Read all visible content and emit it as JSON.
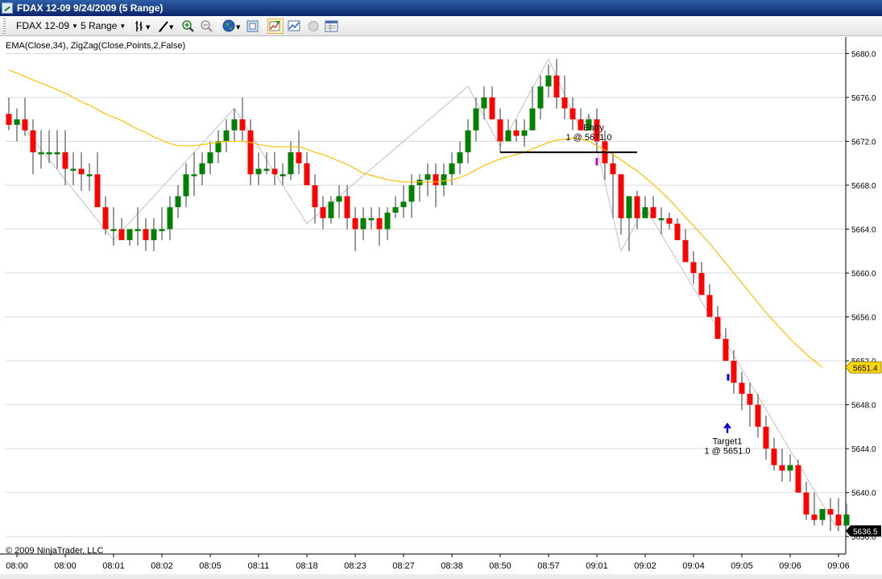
{
  "window": {
    "title": "FDAX 12-09  9/24/2009 (5 Range)"
  },
  "toolbar": {
    "instrument": "FDAX 12-09",
    "period": "5 Range",
    "icons": [
      "bar-style-icon",
      "drawing-pen-icon",
      "zoom-in-icon",
      "zoom-out-icon",
      "globe-icon",
      "properties-icon",
      "strategy-icon",
      "chart-trader-icon",
      "record-icon",
      "data-box-icon"
    ]
  },
  "chart": {
    "indicator_label": "EMA(Close,34), ZigZag(Close,Points,2,False)",
    "copyright": "© 2009 NinjaTrader, LLC",
    "colors": {
      "up": "#008000",
      "down": "#ff0000",
      "wick": "#808080",
      "ema": "#ffc000",
      "zigzag": "#c0c0c0",
      "grid": "#d9d9d9",
      "entry_line": "#000000",
      "target_arrow": "#0000cc",
      "last_price_marker": "#000000",
      "ema_marker": "#ffd700"
    }
  },
  "chart_data": {
    "type": "candlestick",
    "title": "",
    "ylim": [
      5634.4,
      5681.5
    ],
    "y_ticks": [
      5680.0,
      5676.0,
      5672.0,
      5668.0,
      5664.0,
      5660.0,
      5656.0,
      5652.0,
      5648.0,
      5644.0,
      5640.0,
      5636.0
    ],
    "y_tick_labels": [
      "5680.0",
      "5676.0",
      "5672.0",
      "5668.0",
      "5664.0",
      "5660.0",
      "5656.0",
      "5652.0",
      "5648.0",
      "5644.0",
      "5640.0",
      "5636.0"
    ],
    "x_tick_labels": [
      "08:00",
      "08:00",
      "08:01",
      "08:02",
      "08:05",
      "08:11",
      "08:18",
      "08:23",
      "08:27",
      "08:38",
      "08:50",
      "08:57",
      "09:01",
      "09:02",
      "09:04",
      "09:05",
      "09:06",
      "09:06"
    ],
    "x_tick_bars": [
      1,
      7,
      13,
      19,
      25,
      31,
      37,
      43,
      49,
      55,
      61,
      67,
      73,
      79,
      85,
      91,
      97,
      103
    ],
    "bars": [
      {
        "o": 5674.5,
        "h": 5676,
        "l": 5673,
        "c": 5673.5
      },
      {
        "o": 5673.5,
        "h": 5675,
        "l": 5672,
        "c": 5674
      },
      {
        "o": 5674,
        "h": 5676,
        "l": 5672.5,
        "c": 5673
      },
      {
        "o": 5673,
        "h": 5674,
        "l": 5669,
        "c": 5671
      },
      {
        "o": 5671,
        "h": 5673,
        "l": 5669.5,
        "c": 5671
      },
      {
        "o": 5671,
        "h": 5673,
        "l": 5670,
        "c": 5671
      },
      {
        "o": 5671,
        "h": 5673,
        "l": 5669.5,
        "c": 5671
      },
      {
        "o": 5671,
        "h": 5673,
        "l": 5668,
        "c": 5669.5
      },
      {
        "o": 5669.5,
        "h": 5671,
        "l": 5668,
        "c": 5669.5
      },
      {
        "o": 5669.5,
        "h": 5671,
        "l": 5667.5,
        "c": 5669
      },
      {
        "o": 5669,
        "h": 5670,
        "l": 5667.5,
        "c": 5669
      },
      {
        "o": 5669,
        "h": 5671,
        "l": 5666,
        "c": 5666
      },
      {
        "o": 5666,
        "h": 5667,
        "l": 5663.5,
        "c": 5664
      },
      {
        "o": 5664,
        "h": 5666,
        "l": 5662.5,
        "c": 5664
      },
      {
        "o": 5664,
        "h": 5665,
        "l": 5663,
        "c": 5663
      },
      {
        "o": 5663,
        "h": 5664,
        "l": 5662.5,
        "c": 5664
      },
      {
        "o": 5664,
        "h": 5666,
        "l": 5662.5,
        "c": 5664
      },
      {
        "o": 5664,
        "h": 5665,
        "l": 5662,
        "c": 5663
      },
      {
        "o": 5663,
        "h": 5665,
        "l": 5662,
        "c": 5664
      },
      {
        "o": 5664,
        "h": 5666,
        "l": 5663,
        "c": 5664
      },
      {
        "o": 5664,
        "h": 5667,
        "l": 5663,
        "c": 5666
      },
      {
        "o": 5666,
        "h": 5668,
        "l": 5665,
        "c": 5667
      },
      {
        "o": 5667,
        "h": 5670,
        "l": 5666,
        "c": 5669
      },
      {
        "o": 5669,
        "h": 5671,
        "l": 5667,
        "c": 5669
      },
      {
        "o": 5669,
        "h": 5671,
        "l": 5668,
        "c": 5670
      },
      {
        "o": 5670,
        "h": 5672,
        "l": 5669,
        "c": 5671
      },
      {
        "o": 5671,
        "h": 5673,
        "l": 5670,
        "c": 5672
      },
      {
        "o": 5672,
        "h": 5674,
        "l": 5671,
        "c": 5673
      },
      {
        "o": 5673,
        "h": 5675,
        "l": 5672,
        "c": 5674
      },
      {
        "o": 5674,
        "h": 5676,
        "l": 5672,
        "c": 5673
      },
      {
        "o": 5673,
        "h": 5674,
        "l": 5668,
        "c": 5669
      },
      {
        "o": 5669,
        "h": 5671,
        "l": 5668,
        "c": 5669.5
      },
      {
        "o": 5669.5,
        "h": 5671,
        "l": 5669,
        "c": 5669.5
      },
      {
        "o": 5669.5,
        "h": 5671,
        "l": 5668,
        "c": 5669
      },
      {
        "o": 5669,
        "h": 5670,
        "l": 5668,
        "c": 5669
      },
      {
        "o": 5669,
        "h": 5672,
        "l": 5668.5,
        "c": 5671
      },
      {
        "o": 5671,
        "h": 5673,
        "l": 5669,
        "c": 5670
      },
      {
        "o": 5670,
        "h": 5671,
        "l": 5668,
        "c": 5668
      },
      {
        "o": 5668,
        "h": 5669,
        "l": 5664.5,
        "c": 5666
      },
      {
        "o": 5666,
        "h": 5667,
        "l": 5664,
        "c": 5665
      },
      {
        "o": 5665,
        "h": 5667,
        "l": 5664.5,
        "c": 5666.5
      },
      {
        "o": 5666.5,
        "h": 5668,
        "l": 5665,
        "c": 5667
      },
      {
        "o": 5667,
        "h": 5668,
        "l": 5664,
        "c": 5665
      },
      {
        "o": 5665,
        "h": 5666,
        "l": 5662,
        "c": 5664
      },
      {
        "o": 5664,
        "h": 5666,
        "l": 5663,
        "c": 5665
      },
      {
        "o": 5665,
        "h": 5666,
        "l": 5664,
        "c": 5665
      },
      {
        "o": 5665,
        "h": 5666,
        "l": 5662.5,
        "c": 5664
      },
      {
        "o": 5664,
        "h": 5666,
        "l": 5663,
        "c": 5665.5
      },
      {
        "o": 5665.5,
        "h": 5667,
        "l": 5665,
        "c": 5666
      },
      {
        "o": 5666,
        "h": 5668,
        "l": 5665,
        "c": 5666.5
      },
      {
        "o": 5666.5,
        "h": 5669,
        "l": 5665,
        "c": 5668
      },
      {
        "o": 5668,
        "h": 5669,
        "l": 5666.5,
        "c": 5668.5
      },
      {
        "o": 5668.5,
        "h": 5670,
        "l": 5667,
        "c": 5669
      },
      {
        "o": 5669,
        "h": 5670,
        "l": 5666,
        "c": 5668
      },
      {
        "o": 5668,
        "h": 5670,
        "l": 5667,
        "c": 5669
      },
      {
        "o": 5669,
        "h": 5671,
        "l": 5668,
        "c": 5670
      },
      {
        "o": 5670,
        "h": 5672,
        "l": 5669,
        "c": 5671
      },
      {
        "o": 5671,
        "h": 5674,
        "l": 5670,
        "c": 5673
      },
      {
        "o": 5673,
        "h": 5676,
        "l": 5672,
        "c": 5675
      },
      {
        "o": 5675,
        "h": 5677,
        "l": 5674,
        "c": 5676
      },
      {
        "o": 5676,
        "h": 5677,
        "l": 5674,
        "c": 5674
      },
      {
        "o": 5674,
        "h": 5675,
        "l": 5671,
        "c": 5672
      },
      {
        "o": 5672,
        "h": 5674,
        "l": 5672,
        "c": 5673
      },
      {
        "o": 5673,
        "h": 5674,
        "l": 5672,
        "c": 5672.5
      },
      {
        "o": 5672.5,
        "h": 5674,
        "l": 5671.5,
        "c": 5673
      },
      {
        "o": 5673,
        "h": 5677,
        "l": 5673,
        "c": 5675
      },
      {
        "o": 5675,
        "h": 5678,
        "l": 5674,
        "c": 5677
      },
      {
        "o": 5677,
        "h": 5679,
        "l": 5676,
        "c": 5678
      },
      {
        "o": 5678,
        "h": 5679.5,
        "l": 5675,
        "c": 5676
      },
      {
        "o": 5676,
        "h": 5678,
        "l": 5674,
        "c": 5675
      },
      {
        "o": 5675,
        "h": 5676,
        "l": 5673,
        "c": 5674
      },
      {
        "o": 5674,
        "h": 5675,
        "l": 5673,
        "c": 5673
      },
      {
        "o": 5673,
        "h": 5674.5,
        "l": 5673,
        "c": 5674
      },
      {
        "o": 5674,
        "h": 5675,
        "l": 5671,
        "c": 5672
      },
      {
        "o": 5672,
        "h": 5673,
        "l": 5668.5,
        "c": 5670
      },
      {
        "o": 5670,
        "h": 5671,
        "l": 5665,
        "c": 5669
      },
      {
        "o": 5669,
        "h": 5669,
        "l": 5663.5,
        "c": 5665
      },
      {
        "o": 5665,
        "h": 5667,
        "l": 5662,
        "c": 5667
      },
      {
        "o": 5667,
        "h": 5667.5,
        "l": 5664,
        "c": 5665
      },
      {
        "o": 5665,
        "h": 5667,
        "l": 5665,
        "c": 5666
      },
      {
        "o": 5666,
        "h": 5667,
        "l": 5665,
        "c": 5665
      },
      {
        "o": 5665,
        "h": 5666,
        "l": 5663.5,
        "c": 5665
      },
      {
        "o": 5665,
        "h": 5665.5,
        "l": 5664,
        "c": 5664.5
      },
      {
        "o": 5664.5,
        "h": 5665,
        "l": 5663,
        "c": 5663
      },
      {
        "o": 5663,
        "h": 5664,
        "l": 5661,
        "c": 5661
      },
      {
        "o": 5661,
        "h": 5662,
        "l": 5659,
        "c": 5660
      },
      {
        "o": 5660,
        "h": 5661,
        "l": 5658,
        "c": 5658
      },
      {
        "o": 5658,
        "h": 5659,
        "l": 5656,
        "c": 5656
      },
      {
        "o": 5656,
        "h": 5657,
        "l": 5654,
        "c": 5654
      },
      {
        "o": 5654,
        "h": 5655,
        "l": 5652,
        "c": 5652
      },
      {
        "o": 5652,
        "h": 5653,
        "l": 5649,
        "c": 5650
      },
      {
        "o": 5650,
        "h": 5651,
        "l": 5647.5,
        "c": 5649
      },
      {
        "o": 5649,
        "h": 5650,
        "l": 5646,
        "c": 5648
      },
      {
        "o": 5648,
        "h": 5649,
        "l": 5645,
        "c": 5646
      },
      {
        "o": 5646,
        "h": 5647,
        "l": 5643,
        "c": 5644
      },
      {
        "o": 5644,
        "h": 5645,
        "l": 5642,
        "c": 5642.5
      },
      {
        "o": 5642.5,
        "h": 5644,
        "l": 5641,
        "c": 5642
      },
      {
        "o": 5642,
        "h": 5643.5,
        "l": 5641,
        "c": 5642.5
      },
      {
        "o": 5642.5,
        "h": 5643,
        "l": 5640,
        "c": 5640
      },
      {
        "o": 5640,
        "h": 5641,
        "l": 5637.5,
        "c": 5638
      },
      {
        "o": 5638,
        "h": 5640,
        "l": 5637,
        "c": 5637.5
      },
      {
        "o": 5637.5,
        "h": 5638.5,
        "l": 5637,
        "c": 5638.5
      },
      {
        "o": 5638.5,
        "h": 5639.5,
        "l": 5636.5,
        "c": 5638
      },
      {
        "o": 5638,
        "h": 5639.5,
        "l": 5636.5,
        "c": 5637
      },
      {
        "o": 5637,
        "h": 5639,
        "l": 5637,
        "c": 5638
      }
    ],
    "ema": [
      5678.5,
      5678.2,
      5677.9,
      5677.6,
      5677.3,
      5677,
      5676.7,
      5676.4,
      5676,
      5675.6,
      5675.3,
      5674.9,
      5674.5,
      5674.2,
      5673.9,
      5673.5,
      5673.1,
      5672.8,
      5672.4,
      5672.1,
      5671.8,
      5671.6,
      5671.6,
      5671.6,
      5671.7,
      5671.8,
      5671.9,
      5672,
      5672,
      5672,
      5671.9,
      5671.7,
      5671.6,
      5671.5,
      5671.5,
      5671.5,
      5671.5,
      5671.3,
      5671,
      5670.8,
      5670.5,
      5670.2,
      5669.9,
      5669.5,
      5669.1,
      5668.9,
      5668.7,
      5668.5,
      5668.4,
      5668.3,
      5668.3,
      5668.3,
      5668.3,
      5668.3,
      5668.4,
      5668.5,
      5668.7,
      5669,
      5669.4,
      5669.8,
      5670.1,
      5670.4,
      5670.6,
      5670.8,
      5671,
      5671.3,
      5671.6,
      5671.9,
      5672.1,
      5672.2,
      5672.3,
      5672.2,
      5672,
      5671.6,
      5671.2,
      5670.8,
      5670.3,
      5669.8,
      5669.3,
      5668.7,
      5668.1,
      5667.4,
      5666.7,
      5665.9,
      5665.1,
      5664.3,
      5663.5,
      5662.7,
      5661.8,
      5660.9,
      5660,
      5659.1,
      5658.2,
      5657.3,
      5656.4,
      5655.6,
      5654.8,
      5654,
      5653.3,
      5652.6,
      5652,
      5651.4
    ],
    "zigzag": [
      {
        "bar": 1,
        "price": 5674
      },
      {
        "bar": 13,
        "price": 5663
      },
      {
        "bar": 28,
        "price": 5675
      },
      {
        "bar": 37,
        "price": 5664.5
      },
      {
        "bar": 57,
        "price": 5677
      },
      {
        "bar": 61,
        "price": 5671.5
      },
      {
        "bar": 67,
        "price": 5679.5
      },
      {
        "bar": 71,
        "price": 5673
      },
      {
        "bar": 72,
        "price": 5674.5
      },
      {
        "bar": 76,
        "price": 5662
      },
      {
        "bar": 79,
        "price": 5666
      },
      {
        "bar": 103,
        "price": 5636.5
      }
    ],
    "entry": {
      "label": "Entry",
      "detail": "1 @ 5671.0",
      "price": 5671.0,
      "bar_start": 61,
      "bar_end": 78
    },
    "target": {
      "label": "Target1",
      "detail": "1 @ 5651.0",
      "price": 5651.0,
      "bar": 88
    },
    "ema_last_label": "5651.4",
    "last_price_label": "5636.5"
  }
}
